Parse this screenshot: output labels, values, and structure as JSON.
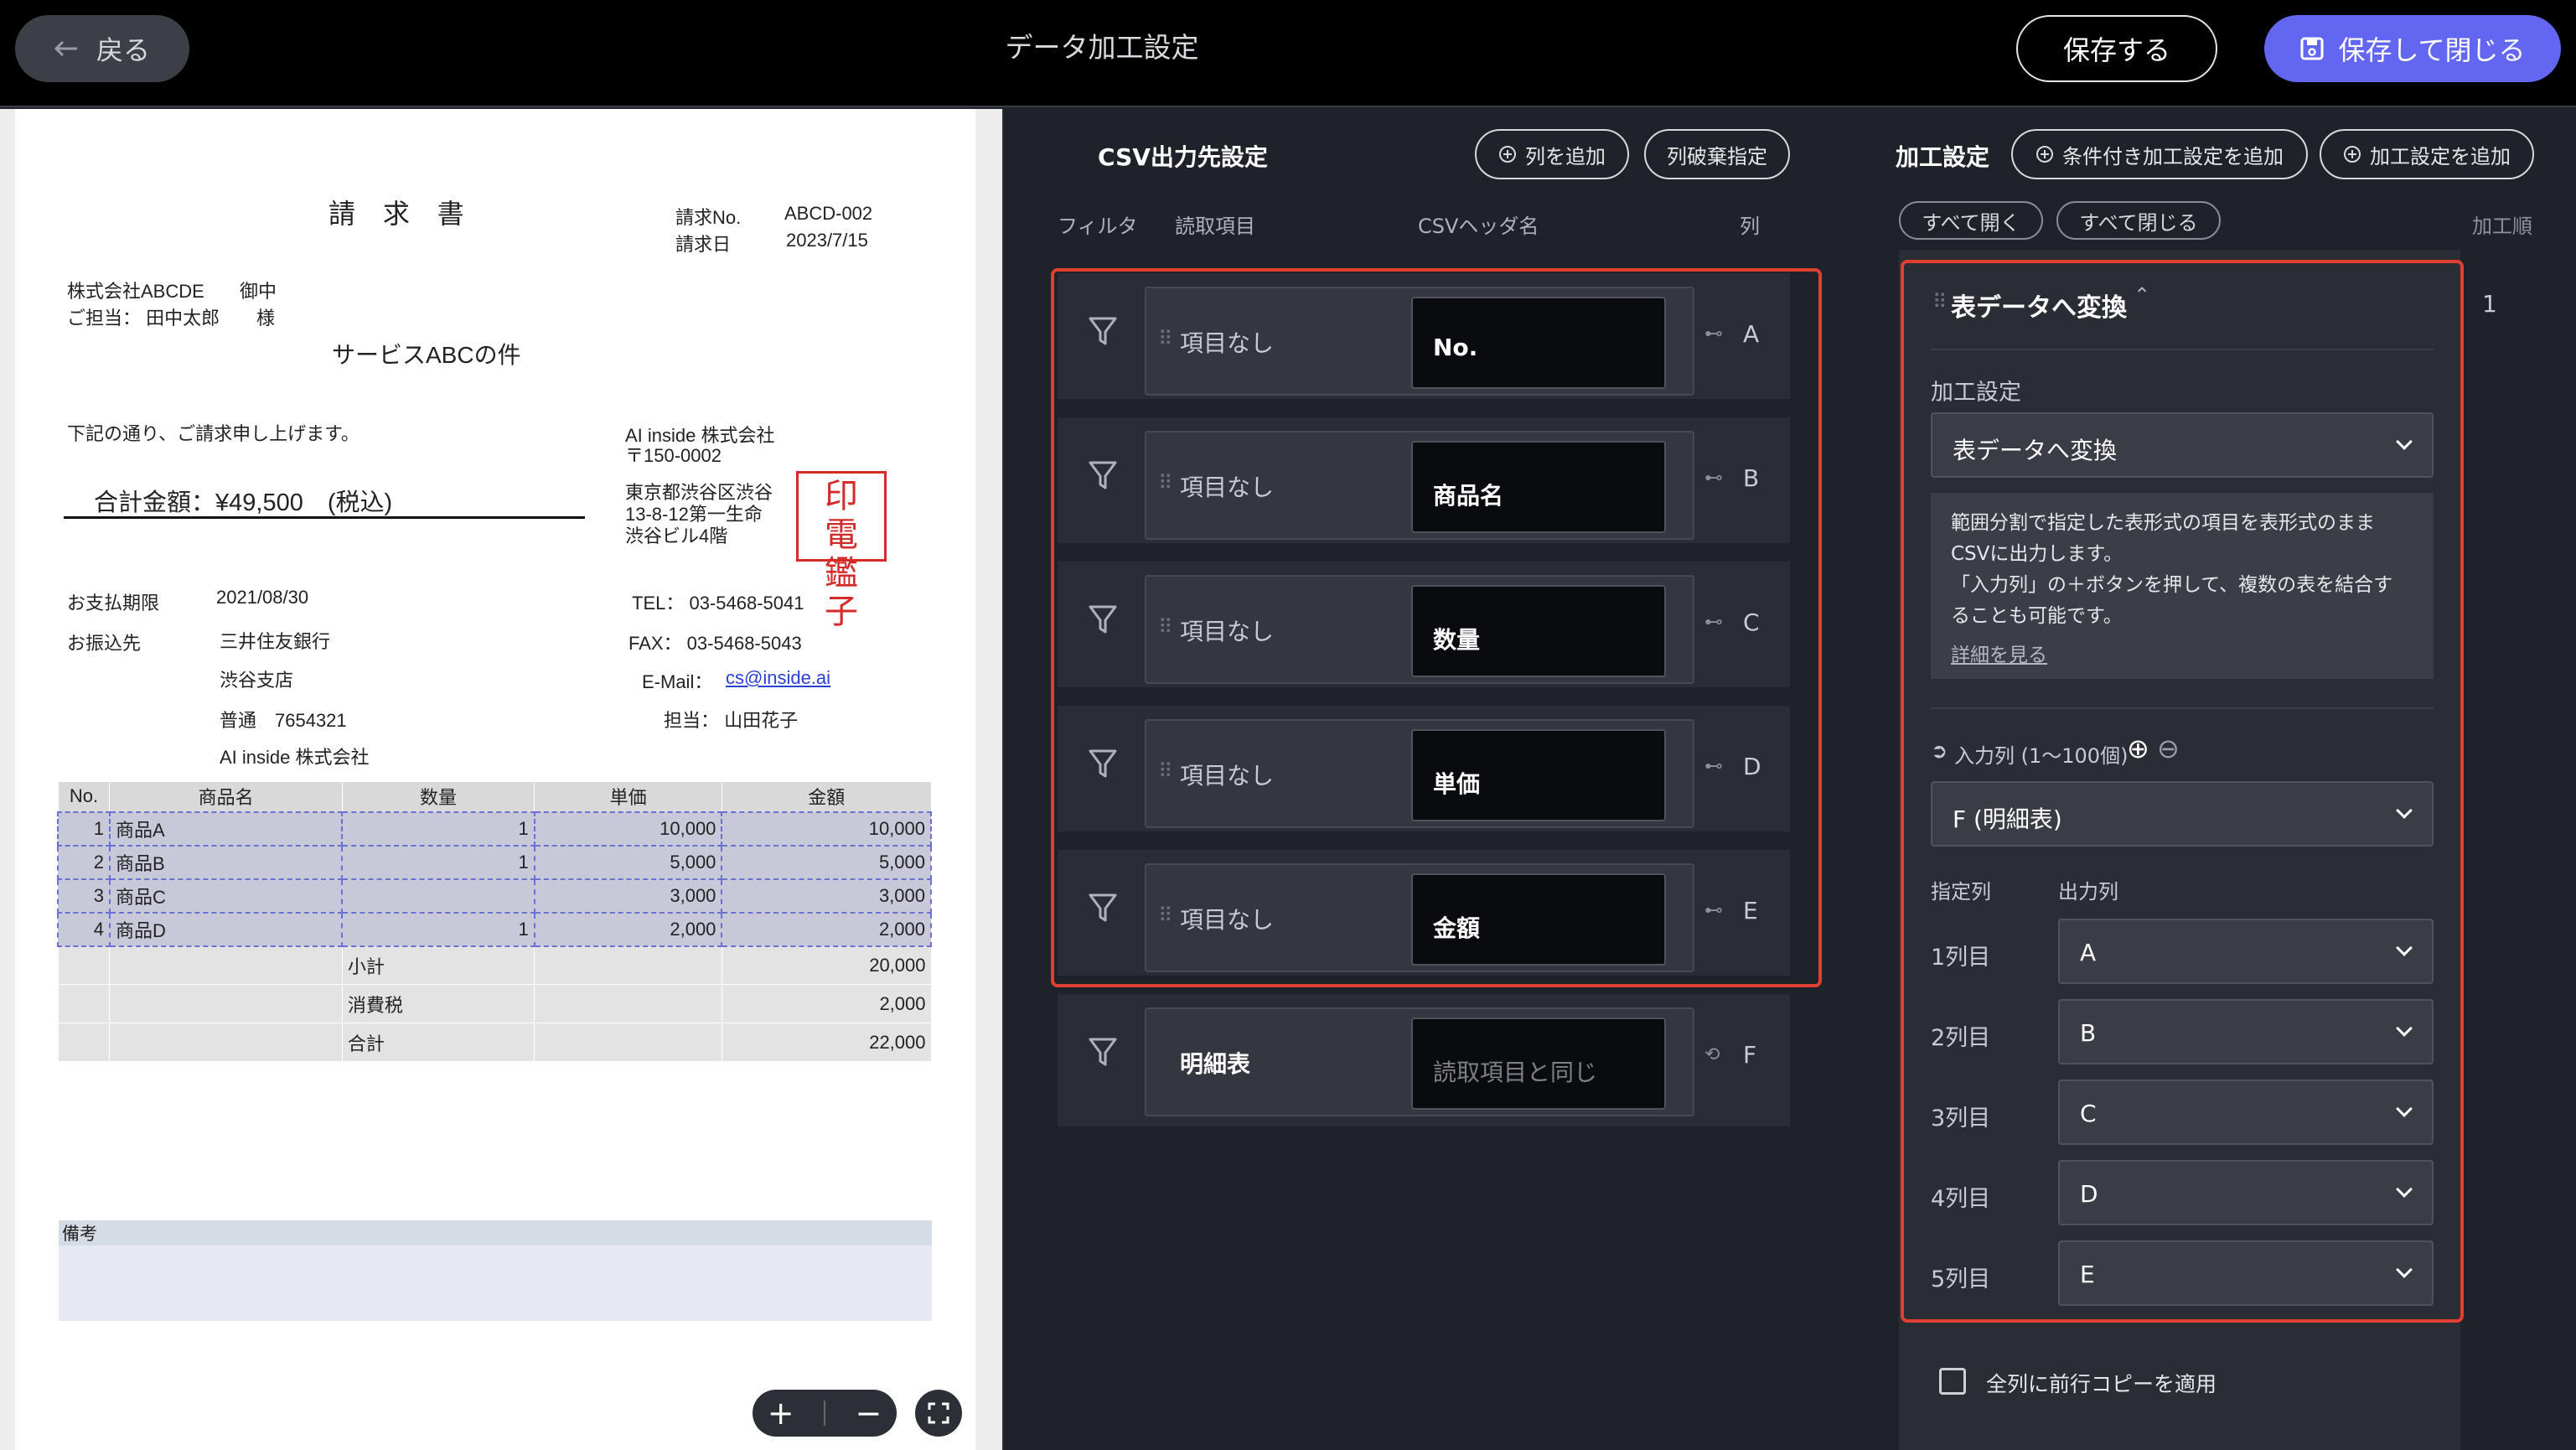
{
  "header": {
    "back_label": "戻る",
    "title": "データ加工設定",
    "save_label": "保存する",
    "save_close_label": "保存して閉じる"
  },
  "invoice": {
    "title": "請 求 書",
    "no_label": "請求No.",
    "no_value": "ABCD-002",
    "date_label": "請求日",
    "date_value": "2023/7/15",
    "client": "株式会社ABCDE",
    "client_suffix": "御中",
    "contact": "ご担当： 田中太郎",
    "contact_suffix": "様",
    "subject": "サービスABCの件",
    "intro": "下記の通り、ご請求申し上げます。",
    "total": "合計金額：¥49,500　(税込)",
    "issuer_name": "AI inside 株式会社",
    "issuer_zip": "〒150-0002",
    "issuer_addr1": "東京都渋谷区渋谷",
    "issuer_addr2": "13-8-12第一生命",
    "issuer_addr3": "渋谷ビル4階",
    "seal_chars": [
      "電",
      "子",
      "印",
      "鑑"
    ],
    "due_label": "お支払期限",
    "due_value": "2021/08/30",
    "bank_label": "お振込先",
    "bank_name": "三井住友銀行",
    "bank_branch": "渋谷支店",
    "bank_account": "普通　7654321",
    "bank_holder": "AI inside 株式会社",
    "tel": "TEL：  03-5468-5041",
    "fax": "FAX：  03-5468-5043",
    "email_label": "E-Mail：",
    "email": "cs@inside.ai",
    "staff": "担当：  山田花子",
    "table_headers": [
      "No.",
      "商品名",
      "数量",
      "単価",
      "金額"
    ],
    "rows": [
      [
        "1",
        "商品A",
        "1",
        "10,000",
        "10,000"
      ],
      [
        "2",
        "商品B",
        "1",
        "5,000",
        "5,000"
      ],
      [
        "3",
        "商品C",
        "",
        "3,000",
        "3,000"
      ],
      [
        "4",
        "商品D",
        "1",
        "2,000",
        "2,000"
      ]
    ],
    "subtotal_label": "小計",
    "subtotal": "20,000",
    "tax_label": "消費税",
    "tax": "2,000",
    "grand_label": "合計",
    "grand": "22,000",
    "notes_label": "備考"
  },
  "zoom": {
    "in": "+",
    "out": "−"
  },
  "csv": {
    "title": "CSV出力先設定",
    "add_col": "列を追加",
    "discard_col": "列破棄指定",
    "col_filter": "フィルタ",
    "col_source": "読取項目",
    "col_header": "CSVヘッダ名",
    "col_col": "列",
    "rows": [
      {
        "source": "項目なし",
        "header": "No.",
        "col": "A"
      },
      {
        "source": "項目なし",
        "header": "商品名",
        "col": "B"
      },
      {
        "source": "項目なし",
        "header": "数量",
        "col": "C"
      },
      {
        "source": "項目なし",
        "header": "単価",
        "col": "D"
      },
      {
        "source": "項目なし",
        "header": "金額",
        "col": "E"
      }
    ],
    "extra_row": {
      "source": "明細表",
      "header_placeholder": "読取項目と同じ",
      "col": "F"
    }
  },
  "settings": {
    "title": "加工設定",
    "add_cond": "条件付き加工設定を追加",
    "add_proc": "加工設定を追加",
    "expand_all": "すべて開く",
    "collapse_all": "すべて閉じる",
    "order_label": "加工順",
    "order_num": "1",
    "card_title": "表データへ変換",
    "proc_label": "加工設定",
    "proc_value": "表データへ変換",
    "desc_line1": "範囲分割で指定した表形式の項目を表形式のまま",
    "desc_line2": "CSVに出力します。",
    "desc_line3": "「入力列」の＋ボタンを押して、複数の表を結合す",
    "desc_line4": "ることも可能です。",
    "desc_link": "詳細を見る",
    "input_label": "入力列 (1〜100個)",
    "input_value": "F (明細表)",
    "spec_col": "指定列",
    "out_col": "出力列",
    "mappings": [
      {
        "label": "1列目",
        "value": "A"
      },
      {
        "label": "2列目",
        "value": "B"
      },
      {
        "label": "3列目",
        "value": "C"
      },
      {
        "label": "4列目",
        "value": "D"
      },
      {
        "label": "5列目",
        "value": "E"
      }
    ],
    "copy_label": "全列に前行コピーを適用"
  }
}
